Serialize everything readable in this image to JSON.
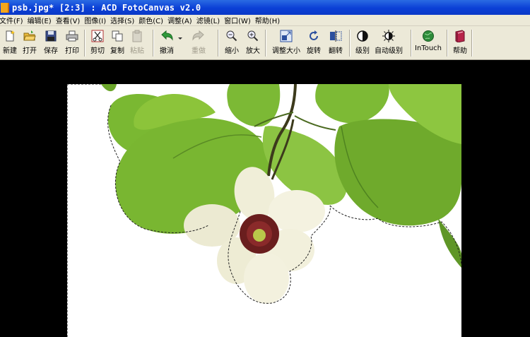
{
  "window": {
    "title": "psb.jpg* [2:3] : ACD FotoCanvas v2.0"
  },
  "menu": [
    {
      "label": "文件(F)"
    },
    {
      "label": "编辑(E)"
    },
    {
      "label": "查看(V)"
    },
    {
      "label": "图像(I)"
    },
    {
      "label": "选择(S)"
    },
    {
      "label": "颜色(C)"
    },
    {
      "label": "调整(A)"
    },
    {
      "label": "滤镜(L)"
    },
    {
      "label": "窗口(W)"
    },
    {
      "label": "帮助(H)"
    }
  ],
  "toolbar": {
    "new": "新建",
    "open": "打开",
    "save": "保存",
    "print": "打印",
    "cut": "剪切",
    "copy": "复制",
    "paste": "粘贴",
    "undo": "撤消",
    "redo": "重做",
    "zoom_out": "缩小",
    "zoom_in": "放大",
    "resize": "调整大小",
    "rotate": "旋转",
    "flip": "翻转",
    "levels": "级别",
    "auto_levels": "自动级别",
    "intouch": "InTouch",
    "help": "帮助",
    "disabled": [
      "paste",
      "redo"
    ]
  },
  "colors": {
    "titlebar": "#0b3fd6",
    "chrome": "#ece9d8",
    "workspace": "#000000",
    "leaf": "#7ab832",
    "petal": "#f2f0dc",
    "flower_center": "#6a1e1e"
  }
}
